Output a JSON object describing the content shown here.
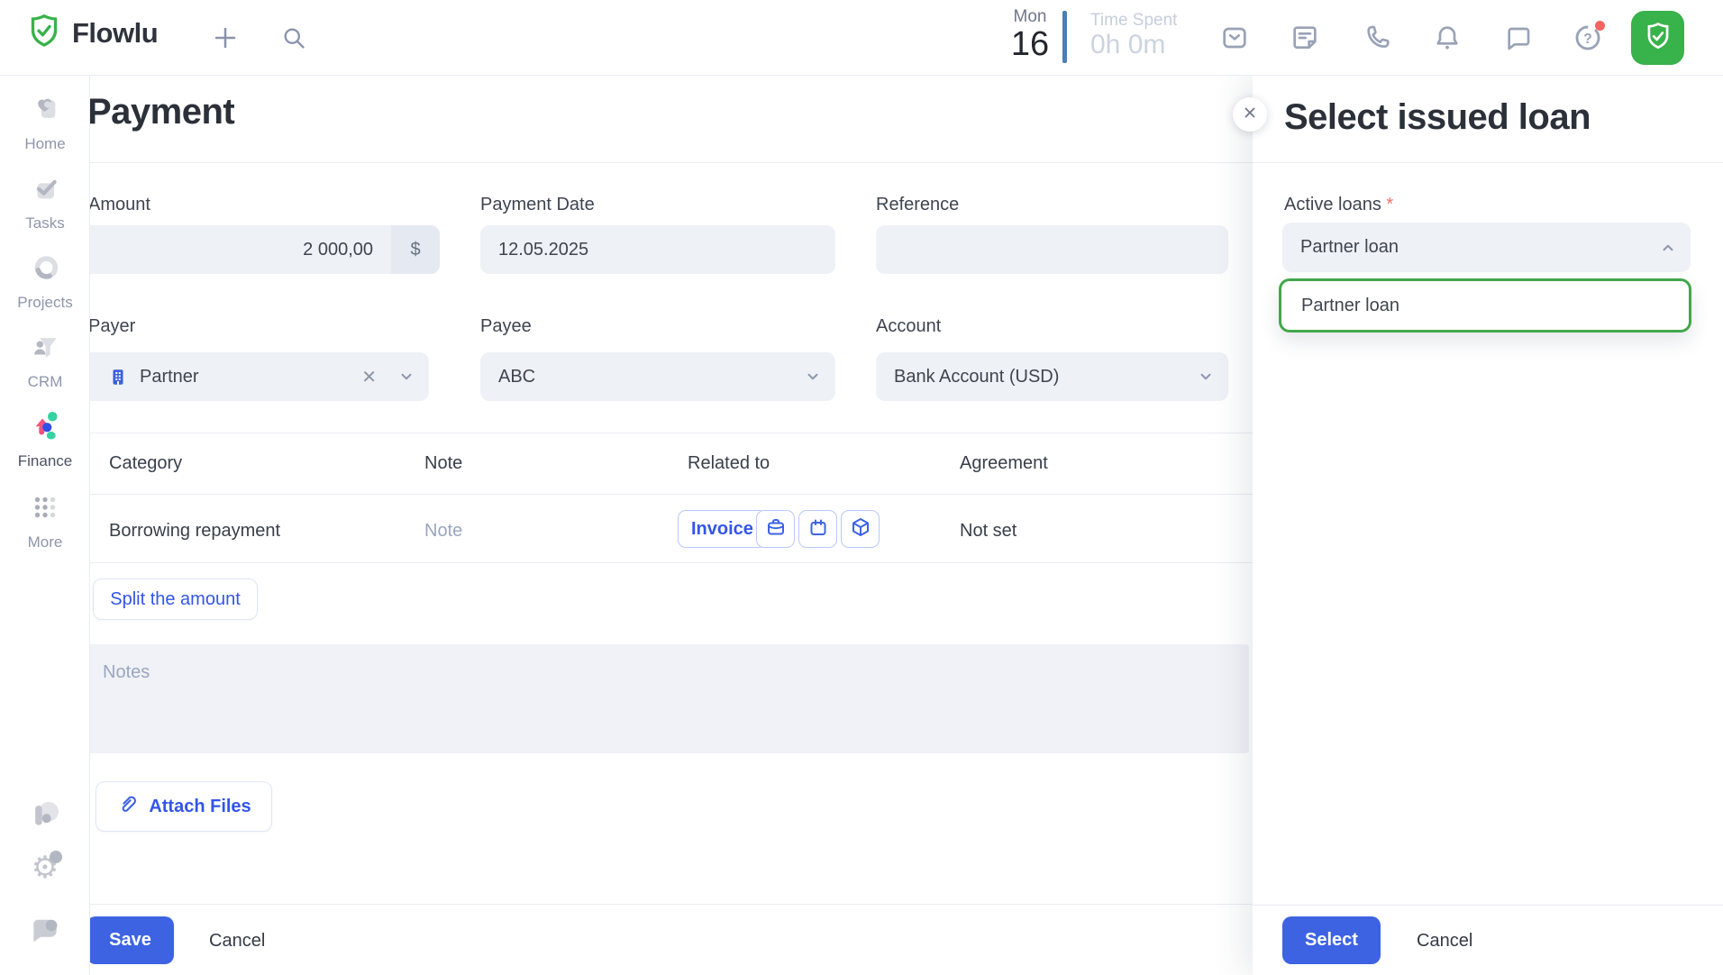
{
  "topbar": {
    "brand": "Flowlu",
    "date_day": "Mon",
    "date_num": "16",
    "time_spent_label": "Time Spent",
    "time_spent_value": "0h 0m"
  },
  "sidebar": {
    "items": [
      {
        "label": "Home"
      },
      {
        "label": "Tasks"
      },
      {
        "label": "Projects"
      },
      {
        "label": "CRM"
      },
      {
        "label": "Finance",
        "active": true
      },
      {
        "label": "More"
      }
    ]
  },
  "payment": {
    "title": "Payment",
    "fields": {
      "amount": {
        "label": "Amount",
        "value": "2 000,00",
        "currency": "$"
      },
      "payment_date": {
        "label": "Payment Date",
        "value": "12.05.2025"
      },
      "reference": {
        "label": "Reference",
        "value": ""
      },
      "payer": {
        "label": "Payer",
        "value": "Partner"
      },
      "payee": {
        "label": "Payee",
        "value": "ABC"
      },
      "account": {
        "label": "Account",
        "value": "Bank Account (USD)"
      }
    },
    "table": {
      "headers": [
        "Category",
        "Note",
        "Related to",
        "Agreement"
      ],
      "row": {
        "category": "Borrowing repayment",
        "note_placeholder": "Note",
        "invoice_label": "Invoice",
        "agreement": "Not set"
      }
    },
    "split_button": "Split the amount",
    "notes_placeholder": "Notes",
    "attach_button": "Attach Files",
    "save_button": "Save",
    "cancel_button": "Cancel"
  },
  "loan_panel": {
    "title": "Select issued loan",
    "active_loans_label": "Active loans",
    "required_mark": "*",
    "select_value": "Partner loan",
    "dropdown_option": "Partner loan",
    "select_button": "Select",
    "cancel_button": "Cancel"
  },
  "colors": {
    "primary_blue": "#3d63e3",
    "link_blue": "#3355e8",
    "accent_green": "#38b24a",
    "option_border_green": "#44a64c",
    "field_bg": "#eef1f6",
    "divider": "#e9ecf2",
    "muted_text": "#9aa6bf",
    "alert_red": "#f4655f",
    "steel_blue_bar": "#4a80b2"
  }
}
